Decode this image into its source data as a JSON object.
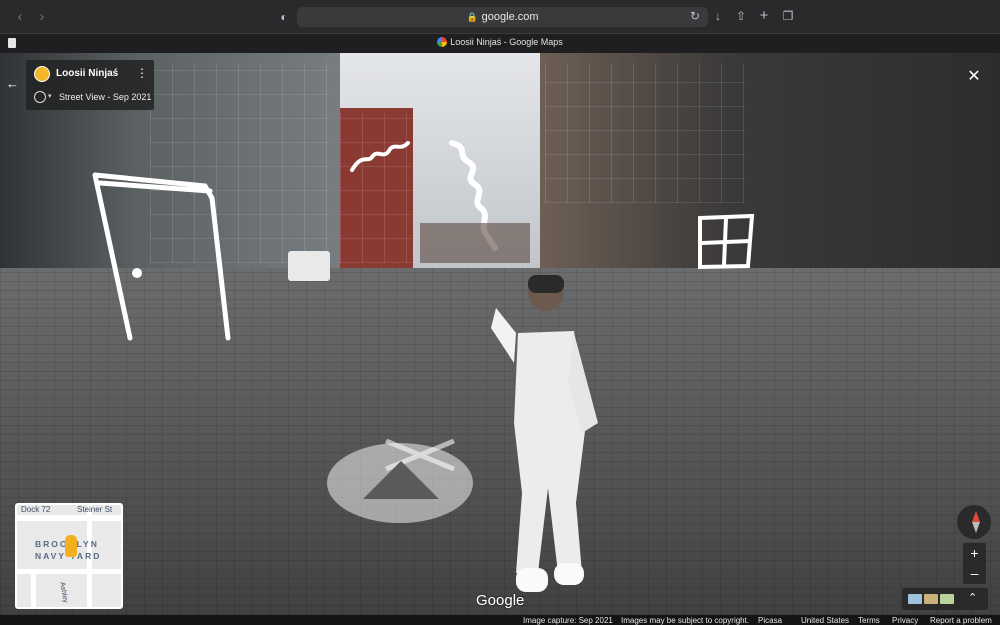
{
  "browser": {
    "address": "google.com",
    "tab_title": "Loosii Ninjaś - Google Maps"
  },
  "info_card": {
    "name": "Loosii Ninjaś",
    "subtitle": "Street View - Sep 2021"
  },
  "minimap": {
    "labels": [
      "Dock 72",
      "Steiner St",
      "BROOKLYN",
      "NAVY YARD",
      "Ashley"
    ]
  },
  "google_logo": "Google",
  "footer": {
    "image_capture": "Image capture: Sep 2021",
    "copyright": "Images may be subject to copyright.",
    "picasa": "Picasa",
    "country": "United States",
    "terms": "Terms",
    "privacy": "Privacy",
    "report": "Report a problem"
  },
  "icons": {
    "back": "chevron-left-icon",
    "forward": "chevron-right-icon",
    "shield": "shield-icon",
    "lock": "lock-icon",
    "reload": "reload-icon",
    "download": "download-icon",
    "share": "share-icon",
    "new_tab": "plus-icon",
    "tabs": "tabs-overview-icon",
    "close": "close-icon",
    "compass": "compass-icon"
  },
  "colors": {
    "chrome_bg": "#2a2a2c",
    "card_bg": "#222222",
    "compass_north": "#e04a3c",
    "pegman": "#f2b01f"
  }
}
